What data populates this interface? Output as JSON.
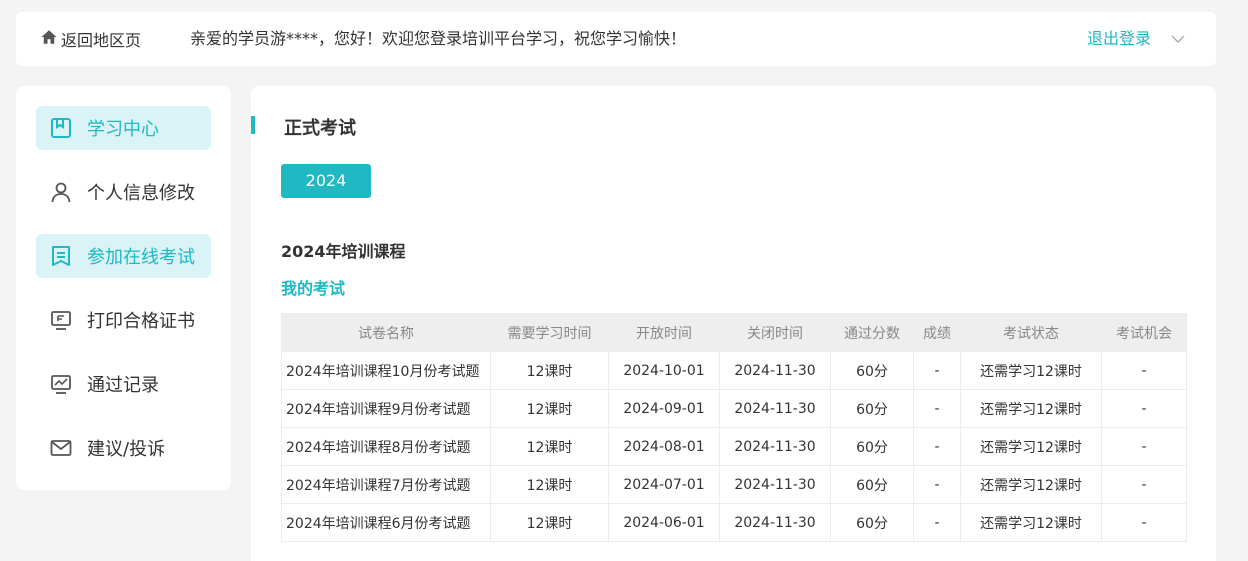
{
  "header": {
    "back_label": "返回地区页",
    "welcome": "亲爱的学员游****，您好！欢迎您登录培训平台学习，祝您学习愉快！",
    "logout_label": "退出登录"
  },
  "sidebar": {
    "items": [
      {
        "label": "学习中心",
        "icon": "bookmark-book-icon",
        "active": true
      },
      {
        "label": "个人信息修改",
        "icon": "user-icon",
        "active": false
      },
      {
        "label": "参加在线考试",
        "icon": "document-icon",
        "active": true
      },
      {
        "label": "打印合格证书",
        "icon": "monitor-icon",
        "active": false
      },
      {
        "label": "通过记录",
        "icon": "chart-icon",
        "active": false
      },
      {
        "label": "建议/投诉",
        "icon": "mail-icon",
        "active": false
      }
    ]
  },
  "main": {
    "section_title": "正式考试",
    "year_button": "2024",
    "course_title": "2024年培训课程",
    "my_exam_label": "我的考试",
    "table": {
      "headers": [
        "试卷名称",
        "需要学习时间",
        "开放时间",
        "关闭时间",
        "通过分数",
        "成绩",
        "考试状态",
        "考试机会"
      ],
      "rows": [
        [
          "2024年培训课程10月份考试题",
          "12课时",
          "2024-10-01",
          "2024-11-30",
          "60分",
          "-",
          "还需学习12课时",
          "-"
        ],
        [
          "2024年培训课程9月份考试题",
          "12课时",
          "2024-09-01",
          "2024-11-30",
          "60分",
          "-",
          "还需学习12课时",
          "-"
        ],
        [
          "2024年培训课程8月份考试题",
          "12课时",
          "2024-08-01",
          "2024-11-30",
          "60分",
          "-",
          "还需学习12课时",
          "-"
        ],
        [
          "2024年培训课程7月份考试题",
          "12课时",
          "2024-07-01",
          "2024-11-30",
          "60分",
          "-",
          "还需学习12课时",
          "-"
        ],
        [
          "2024年培训课程6月份考试题",
          "12课时",
          "2024-06-01",
          "2024-11-30",
          "60分",
          "-",
          "还需学习12课时",
          "-"
        ]
      ]
    }
  },
  "colors": {
    "accent": "#1fb8c3",
    "active_bg": "#d9f3f6",
    "page_bg": "#f4f4f4"
  }
}
